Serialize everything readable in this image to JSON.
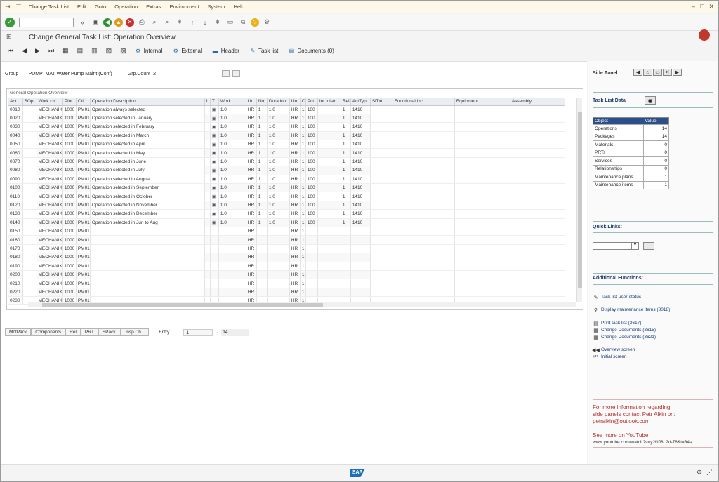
{
  "menubar": {
    "items": [
      "Change Task List",
      "Edit",
      "Goto",
      "Operation",
      "Extras",
      "Environment",
      "System",
      "Help"
    ]
  },
  "title": "Change General Task List: Operation Overview",
  "app_toolbar": {
    "internal": "Internal",
    "external": "External",
    "header": "Header",
    "task_list": "Task list",
    "documents": "Documents (0)"
  },
  "group": {
    "group_label": "Group",
    "group_value": "PUMP_MAT Water Pump Maint (Conf)",
    "counter_label": "Grp.Count",
    "counter_value": "2"
  },
  "table": {
    "title": "General Operation Overview",
    "columns": [
      "Act",
      "SOp",
      "Work ctr",
      "Plnt",
      "Ctl",
      "Operation Description",
      "L",
      "T",
      "Work",
      "Un",
      "No.",
      "Duration",
      "Un",
      "C",
      "Pct",
      "Int. distr",
      "Rel",
      "ActTyp",
      "SlTxt...",
      "Functional loc.",
      "Equipment",
      "Assembly"
    ],
    "rows": [
      {
        "act": "0010",
        "wc": "MECHANIK",
        "plnt": "1000",
        "ctl": "PM01",
        "desc": "Operation always selected",
        "work": "1.0",
        "un": "HR",
        "no": "1",
        "dur": "1.0",
        "un2": "HR",
        "c": "1",
        "pct": "100",
        "rel": "1",
        "acttyp": "1410"
      },
      {
        "act": "0020",
        "wc": "MECHANIK",
        "plnt": "1000",
        "ctl": "PM01",
        "desc": "Operation selected in January",
        "work": "1.0",
        "un": "HR",
        "no": "1",
        "dur": "1.0",
        "un2": "HR",
        "c": "1",
        "pct": "100",
        "rel": "1",
        "acttyp": "1410"
      },
      {
        "act": "0030",
        "wc": "MECHANIK",
        "plnt": "1000",
        "ctl": "PM01",
        "desc": "Operation selected in February",
        "work": "1.0",
        "un": "HR",
        "no": "1",
        "dur": "1.0",
        "un2": "HR",
        "c": "1",
        "pct": "100",
        "rel": "1",
        "acttyp": "1410"
      },
      {
        "act": "0040",
        "wc": "MECHANIK",
        "plnt": "1000",
        "ctl": "PM01",
        "desc": "Operation selected in March",
        "work": "1.0",
        "un": "HR",
        "no": "1",
        "dur": "1.0",
        "un2": "HR",
        "c": "1",
        "pct": "100",
        "rel": "1",
        "acttyp": "1410"
      },
      {
        "act": "0050",
        "wc": "MECHANIK",
        "plnt": "1000",
        "ctl": "PM01",
        "desc": "Operation selected in April",
        "work": "1.0",
        "un": "HR",
        "no": "1",
        "dur": "1.0",
        "un2": "HR",
        "c": "1",
        "pct": "100",
        "rel": "1",
        "acttyp": "1410"
      },
      {
        "act": "0060",
        "wc": "MECHANIK",
        "plnt": "1000",
        "ctl": "PM01",
        "desc": "Operation selected in May",
        "work": "1.0",
        "un": "HR",
        "no": "1",
        "dur": "1.0",
        "un2": "HR",
        "c": "1",
        "pct": "100",
        "rel": "1",
        "acttyp": "1410"
      },
      {
        "act": "0070",
        "wc": "MECHANIK",
        "plnt": "1000",
        "ctl": "PM01",
        "desc": "Operation selected in June",
        "work": "1.0",
        "un": "HR",
        "no": "1",
        "dur": "1.0",
        "un2": "HR",
        "c": "1",
        "pct": "100",
        "rel": "1",
        "acttyp": "1410"
      },
      {
        "act": "0080",
        "wc": "MECHANIK",
        "plnt": "1000",
        "ctl": "PM01",
        "desc": "Operation selected in July",
        "work": "1.0",
        "un": "HR",
        "no": "1",
        "dur": "1.0",
        "un2": "HR",
        "c": "1",
        "pct": "100",
        "rel": "1",
        "acttyp": "1410"
      },
      {
        "act": "0090",
        "wc": "MECHANIK",
        "plnt": "1000",
        "ctl": "PM01",
        "desc": "Operation selected in August",
        "work": "1.0",
        "un": "HR",
        "no": "1",
        "dur": "1.0",
        "un2": "HR",
        "c": "1",
        "pct": "100",
        "rel": "1",
        "acttyp": "1410"
      },
      {
        "act": "0100",
        "wc": "MECHANIK",
        "plnt": "1000",
        "ctl": "PM01",
        "desc": "Operation selected in September",
        "work": "1.0",
        "un": "HR",
        "no": "1",
        "dur": "1.0",
        "un2": "HR",
        "c": "1",
        "pct": "100",
        "rel": "1",
        "acttyp": "1410"
      },
      {
        "act": "0110",
        "wc": "MECHANIK",
        "plnt": "1000",
        "ctl": "PM01",
        "desc": "Operation selected in October",
        "work": "1.0",
        "un": "HR",
        "no": "1",
        "dur": "1.0",
        "un2": "HR",
        "c": "1",
        "pct": "100",
        "rel": "1",
        "acttyp": "1410"
      },
      {
        "act": "0120",
        "wc": "MECHANIK",
        "plnt": "1000",
        "ctl": "PM01",
        "desc": "Operation selected in November",
        "work": "1.0",
        "un": "HR",
        "no": "1",
        "dur": "1.0",
        "un2": "HR",
        "c": "1",
        "pct": "100",
        "rel": "1",
        "acttyp": "1410"
      },
      {
        "act": "0130",
        "wc": "MECHANIK",
        "plnt": "1000",
        "ctl": "PM01",
        "desc": "Operation selected in December",
        "work": "1.0",
        "un": "HR",
        "no": "1",
        "dur": "1.0",
        "un2": "HR",
        "c": "1",
        "pct": "100",
        "rel": "1",
        "acttyp": "1410"
      },
      {
        "act": "0140",
        "wc": "MECHANIK",
        "plnt": "1000",
        "ctl": "PM01",
        "desc": "Operation selected in Jun to Aug",
        "work": "1.0",
        "un": "HR",
        "no": "1",
        "dur": "1.0",
        "un2": "HR",
        "c": "1",
        "pct": "100",
        "rel": "1",
        "acttyp": "1410"
      },
      {
        "act": "0150",
        "wc": "MECHANIK",
        "plnt": "1000",
        "ctl": "PM01",
        "desc": "",
        "work": "",
        "un": "HR",
        "no": "",
        "dur": "",
        "un2": "HR",
        "c": "1",
        "pct": "",
        "rel": "",
        "acttyp": ""
      },
      {
        "act": "0160",
        "wc": "MECHANIK",
        "plnt": "1000",
        "ctl": "PM01",
        "desc": "",
        "work": "",
        "un": "HR",
        "no": "",
        "dur": "",
        "un2": "HR",
        "c": "1",
        "pct": "",
        "rel": "",
        "acttyp": ""
      },
      {
        "act": "0170",
        "wc": "MECHANIK",
        "plnt": "1000",
        "ctl": "PM01",
        "desc": "",
        "work": "",
        "un": "HR",
        "no": "",
        "dur": "",
        "un2": "HR",
        "c": "1",
        "pct": "",
        "rel": "",
        "acttyp": ""
      },
      {
        "act": "0180",
        "wc": "MECHANIK",
        "plnt": "1000",
        "ctl": "PM01",
        "desc": "",
        "work": "",
        "un": "HR",
        "no": "",
        "dur": "",
        "un2": "HR",
        "c": "1",
        "pct": "",
        "rel": "",
        "acttyp": ""
      },
      {
        "act": "0190",
        "wc": "MECHANIK",
        "plnt": "1000",
        "ctl": "PM01",
        "desc": "",
        "work": "",
        "un": "HR",
        "no": "",
        "dur": "",
        "un2": "HR",
        "c": "1",
        "pct": "",
        "rel": "",
        "acttyp": ""
      },
      {
        "act": "0200",
        "wc": "MECHANIK",
        "plnt": "1000",
        "ctl": "PM01",
        "desc": "",
        "work": "",
        "un": "HR",
        "no": "",
        "dur": "",
        "un2": "HR",
        "c": "1",
        "pct": "",
        "rel": "",
        "acttyp": ""
      },
      {
        "act": "0210",
        "wc": "MECHANIK",
        "plnt": "1000",
        "ctl": "PM01",
        "desc": "",
        "work": "",
        "un": "HR",
        "no": "",
        "dur": "",
        "un2": "HR",
        "c": "1",
        "pct": "",
        "rel": "",
        "acttyp": ""
      },
      {
        "act": "0220",
        "wc": "MECHANIK",
        "plnt": "1000",
        "ctl": "PM01",
        "desc": "",
        "work": "",
        "un": "HR",
        "no": "",
        "dur": "",
        "un2": "HR",
        "c": "1",
        "pct": "",
        "rel": "",
        "acttyp": ""
      },
      {
        "act": "0230",
        "wc": "MECHANIK",
        "plnt": "1000",
        "ctl": "PM01",
        "desc": "",
        "work": "",
        "un": "HR",
        "no": "",
        "dur": "",
        "un2": "HR",
        "c": "1",
        "pct": "",
        "rel": "",
        "acttyp": ""
      }
    ]
  },
  "bottom_buttons": [
    "MntPack",
    "Components",
    "Rel",
    "PRT",
    "SPack.",
    "Insp.Ch..."
  ],
  "entry": {
    "label": "Entry",
    "value": "1",
    "of": "/",
    "total": "14"
  },
  "side_panel": {
    "title": "Side Panel",
    "task_list_data": "Task List Data",
    "table_headers": [
      "Object",
      "Value"
    ],
    "table_rows": [
      {
        "object": "Operations",
        "value": "14"
      },
      {
        "object": "Packages",
        "value": "14"
      },
      {
        "object": "Materials",
        "value": "0"
      },
      {
        "object": "PRTs",
        "value": "0"
      },
      {
        "object": "Services",
        "value": "0"
      },
      {
        "object": "Relationships",
        "value": "0"
      },
      {
        "object": "Maintenance plans",
        "value": "1"
      },
      {
        "object": "Maintenance items",
        "value": "1"
      }
    ],
    "quick_links": "Quick Links:",
    "additional_functions": "Additional Functions:",
    "functions": [
      "Task list user-status",
      "Display maintenance items (3018)",
      "Print task list (3617)",
      "Change Documents (3615)",
      "Change Documents (3621)"
    ],
    "nav_links": [
      "Overview screen",
      "Initial screen"
    ],
    "promo_text": [
      "For more information regarding",
      "side panels contact Petr Alkin on:",
      "petralkin@outlook.com"
    ],
    "youtube_label": "See more on YouTube:",
    "youtube_url": "www.youtube.com/watch?v=y2NJ8L2d-78&t=34s"
  },
  "colors": {
    "accent": "#2c4f8a",
    "promo": "#b03030",
    "ok": "#3a9b3a"
  }
}
